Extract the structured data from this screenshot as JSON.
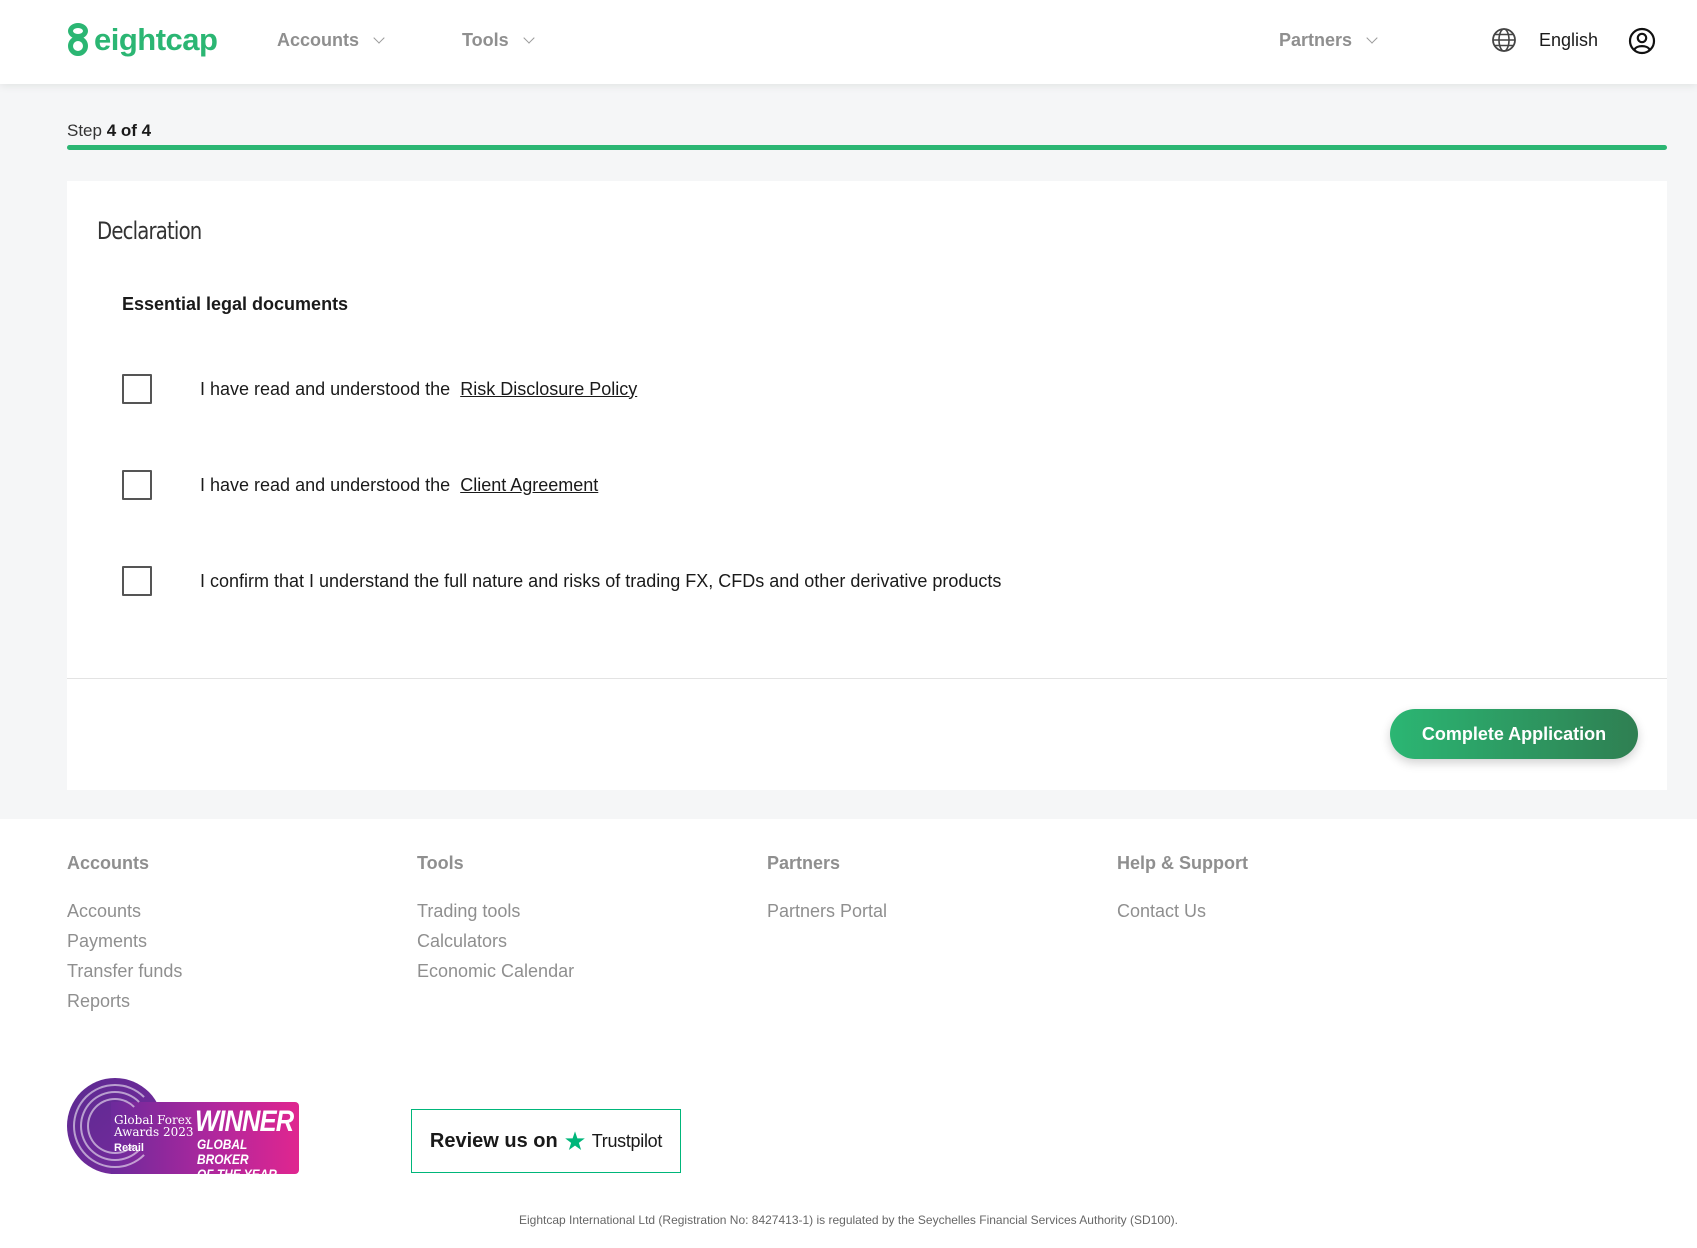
{
  "header": {
    "logo_text": "eightcap",
    "nav": [
      {
        "label": "Accounts"
      },
      {
        "label": "Tools"
      },
      {
        "label": "Partners"
      }
    ],
    "language": "English"
  },
  "step": {
    "prefix": "Step",
    "current": "4 of 4",
    "progress_fraction": 1.0
  },
  "card": {
    "title": "Declaration",
    "section_title": "Essential legal documents",
    "checks": [
      {
        "text": "I have read and understood the",
        "link": "Risk Disclosure Policy",
        "checked": false
      },
      {
        "text": "I have read and understood the",
        "link": "Client Agreement",
        "checked": false
      },
      {
        "text": "I confirm that I understand the full nature and risks of trading FX, CFDs and other derivative products",
        "link": "",
        "checked": false
      }
    ],
    "button_label": "Complete Application"
  },
  "footer": {
    "columns": [
      {
        "heading": "Accounts",
        "links": [
          "Accounts",
          "Payments",
          "Transfer funds",
          "Reports"
        ]
      },
      {
        "heading": "Tools",
        "links": [
          "Trading tools",
          "Calculators",
          "Economic Calendar"
        ]
      },
      {
        "heading": "Partners",
        "links": [
          "Partners Portal"
        ]
      },
      {
        "heading": "Help & Support",
        "links": [
          "Contact Us"
        ]
      }
    ],
    "award": {
      "line1": "Global Forex",
      "line2": "Awards 2023",
      "line3": "Retail",
      "winner": "WINNER",
      "sub1": "GLOBAL BROKER",
      "sub2": "OF THE YEAR"
    },
    "trustpilot": {
      "text": "Review us on",
      "brand": "Trustpilot"
    },
    "legal": "Eightcap International Ltd (Registration No: 8427413-1) is regulated by the Seychelles Financial Services Authority (SD100)."
  },
  "colors": {
    "brand_green": "#2bb673",
    "button_gradient_end": "#2f7f52",
    "muted_text": "#8f8f8f"
  }
}
